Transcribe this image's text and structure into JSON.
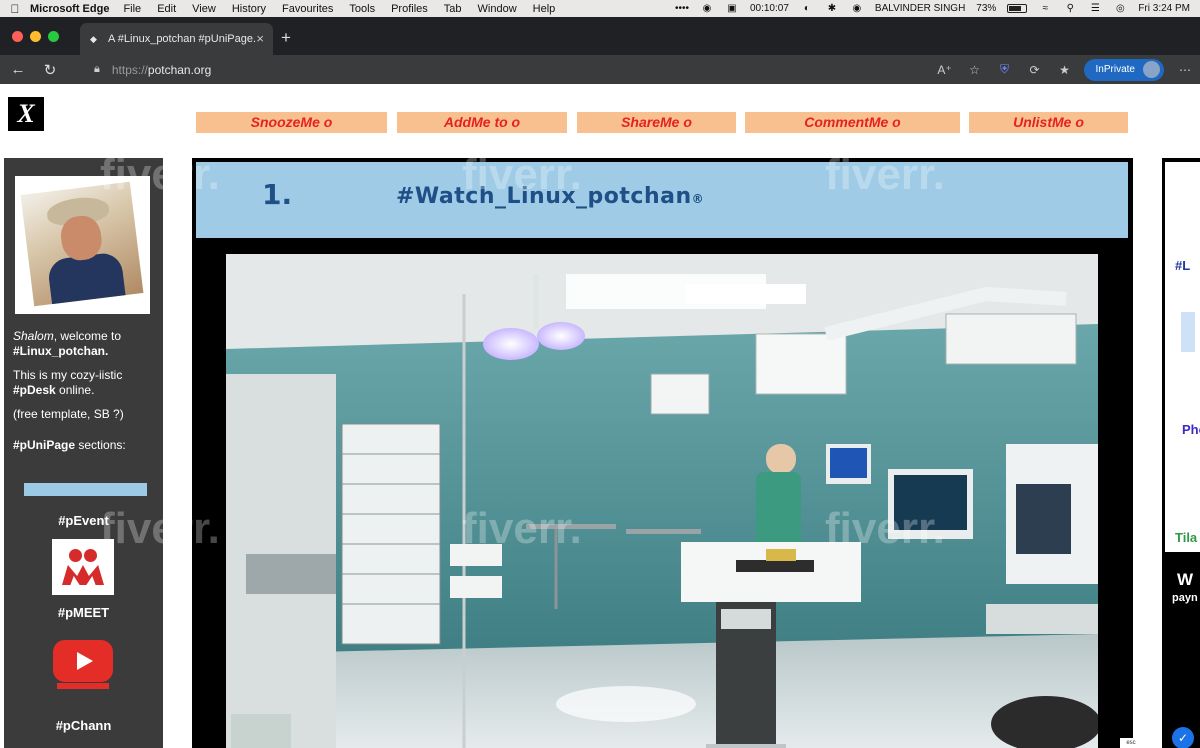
{
  "menubar": {
    "app_name": "Microsoft Edge",
    "items": [
      "File",
      "Edit",
      "View",
      "History",
      "Favourites",
      "Tools",
      "Profiles",
      "Tab",
      "Window",
      "Help"
    ],
    "timer": "00:10:07",
    "user": "BALVINDER SINGH",
    "battery": "73%",
    "clock": "Fri 3:24 PM"
  },
  "tab": {
    "title": "A #Linux_potchan #pUniPage."
  },
  "address": {
    "scheme": "https://",
    "host": "potchan.org"
  },
  "toolbar": {
    "inprivate_label": "InPrivate"
  },
  "page": {
    "logo_letter": "X",
    "top_buttons": [
      "SnoozeMe o",
      "AddMe to o",
      "ShareMe o",
      "CommentMe o",
      "UnlistMe o"
    ],
    "banner": {
      "number": "1.",
      "hashtag": "#Watch_Linux_potchan",
      "mark": "®"
    },
    "sidebar": {
      "welcome_italic": "Shalom",
      "welcome_rest": ", welcome to",
      "welcome_tag": "#Linux_potchan.",
      "desk_line": "This is my cozy-iistic",
      "desk_tag": "#pDesk",
      "desk_rest": " online.",
      "template_note": "(free template, SB ?)",
      "sections_tag": "#pUniPage",
      "sections_rest": " sections:",
      "sections": [
        "#pEvent",
        "#pMEET",
        "#pChann"
      ]
    },
    "right_panel": {
      "texts": [
        "#L",
        "Pho",
        "Tila",
        "W",
        "payn"
      ]
    },
    "watermark": "fiverr.",
    "esc_label": "esc"
  }
}
